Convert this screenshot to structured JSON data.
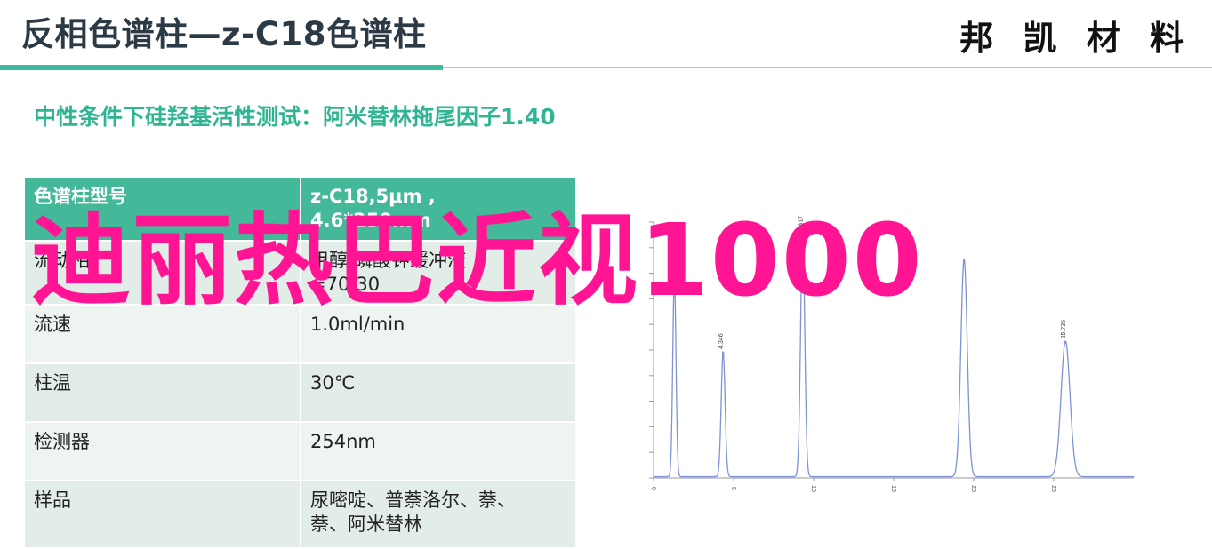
{
  "header": {
    "title": "反相色谱柱—z-C18色谱柱",
    "brand": "邦 凯 材 料"
  },
  "subtitle": "中性条件下硅羟基活性测试：阿米替林拖尾因子1.40",
  "table": {
    "header": {
      "key": "色谱柱型号",
      "value_line1": "z-C18,5μm ,",
      "value_line2": "4.6*250mm"
    },
    "rows": [
      {
        "key": "流动相",
        "value_line1": "甲醇/磷酸钾缓冲液",
        "value_line2": "=70/30"
      },
      {
        "key": "流速",
        "value_line1": "1.0ml/min",
        "value_line2": ""
      },
      {
        "key": "柱温",
        "value_line1": "30℃",
        "value_line2": ""
      },
      {
        "key": "检测器",
        "value_line1": "254nm",
        "value_line2": ""
      },
      {
        "key": "样品",
        "value_line1": "尿嘧啶、普萘洛尔、萘、",
        "value_line2": "萘、阿米替林"
      }
    ]
  },
  "overlay_text": "迪丽热巴近视1000",
  "colors": {
    "accent": "#3dbb9d",
    "overlay": "#ff1493",
    "trace": "#7f93d6"
  },
  "chart_data": {
    "type": "line",
    "ylabel": "AU",
    "xlim": [
      0,
      30
    ],
    "x_ticks": [
      "0",
      "5",
      "10",
      "15",
      "20",
      "25"
    ],
    "peaks": [
      {
        "rt": 1.3,
        "height": 0.78,
        "width": 0.1,
        "label": ""
      },
      {
        "rt": 4.346,
        "height": 0.49,
        "width": 0.12,
        "label": "4.346"
      },
      {
        "rt": 9.317,
        "height": 0.95,
        "width": 0.13,
        "label": "9.317"
      },
      {
        "rt": 19.4,
        "height": 0.85,
        "width": 0.2,
        "label": ""
      },
      {
        "rt": 25.735,
        "height": 0.53,
        "width": 0.28,
        "label": "25.735"
      }
    ]
  }
}
